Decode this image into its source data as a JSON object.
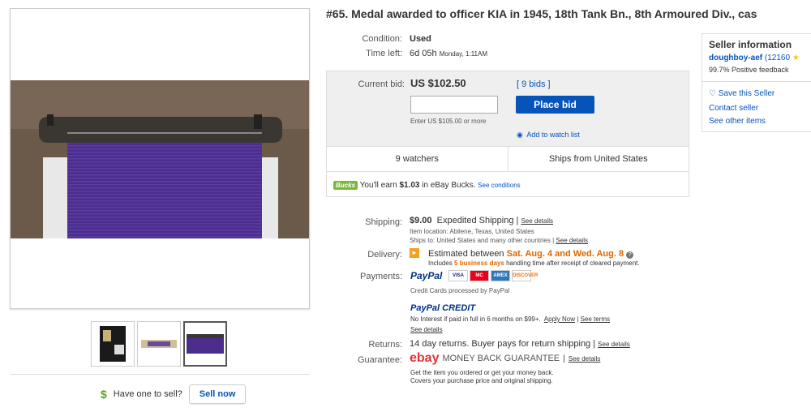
{
  "listing": {
    "title": "#65. Medal awarded to officer KIA in 1945, 18th Tank Bn., 8th Armoured Div., cas"
  },
  "condition": {
    "label": "Condition:",
    "value": "Used"
  },
  "time_left": {
    "label": "Time left:",
    "value": "6d 05h",
    "end": "Monday, 1:11AM"
  },
  "bid": {
    "label": "Current bid:",
    "value": "US $102.50",
    "bids": "[ 9 bids ]",
    "input_hint": "Enter US $105.00 or more",
    "place_bid": "Place bid",
    "watch": "Add to watch list",
    "watchers": "9 watchers",
    "ships_from": "Ships from United States",
    "bucks_badge": "Bucks",
    "bucks_text_pre": "You'll earn ",
    "bucks_amount": "$1.03",
    "bucks_text_post": " in eBay Bucks.",
    "see_conditions": "See conditions"
  },
  "shipping": {
    "label": "Shipping:",
    "price": "$9.00",
    "method": "Expedited Shipping",
    "sep": "|",
    "see_details": "See details",
    "location": "Item location:  Abilene, Texas, United States",
    "ships_to": "Ships to:  United States and many other countries",
    "see_details2": "See details"
  },
  "delivery": {
    "label": "Delivery:",
    "est_pre": "Estimated between ",
    "dates": "Sat. Aug. 4 and Wed. Aug. 8",
    "includes_pre": "Includes ",
    "business_days": "5 business days",
    "includes_post": " handling time after receipt of cleared payment."
  },
  "payments": {
    "label": "Payments:",
    "paypal": "PayPal",
    "cards": [
      "VISA",
      "MC",
      "AMEX",
      "DISCOVER"
    ],
    "cc_note": "Credit Cards processed by PayPal",
    "credit_logo": "PayPal CREDIT",
    "credit_text": "No Interest if paid in full in 6 months on $99+.",
    "apply": "Apply Now",
    "see_terms": "See terms",
    "see_details": "See details"
  },
  "returns": {
    "label": "Returns:",
    "value": "14 day returns. Buyer pays for return shipping",
    "see_details": "See details"
  },
  "guarantee": {
    "label": "Guarantee:",
    "ebay": "ebay",
    "mbg": "MONEY BACK GUARANTEE",
    "see_details": "See details",
    "line1": "Get the item you ordered or get your money back.",
    "line2": "Covers your purchase price and original shipping."
  },
  "seller": {
    "heading": "Seller information",
    "name": "doughboy-aef",
    "score": "(12160",
    "feedback": "99.7% Positive feedback",
    "save": "Save this Seller",
    "contact": "Contact seller",
    "other": "See other items"
  },
  "sell": {
    "question": "Have one to sell?",
    "button": "Sell now"
  },
  "colors": {
    "link": "#0654ba",
    "button": "#0654ba",
    "delivery_dates": "#dd6600",
    "ribbon": "#4a2d8c"
  }
}
